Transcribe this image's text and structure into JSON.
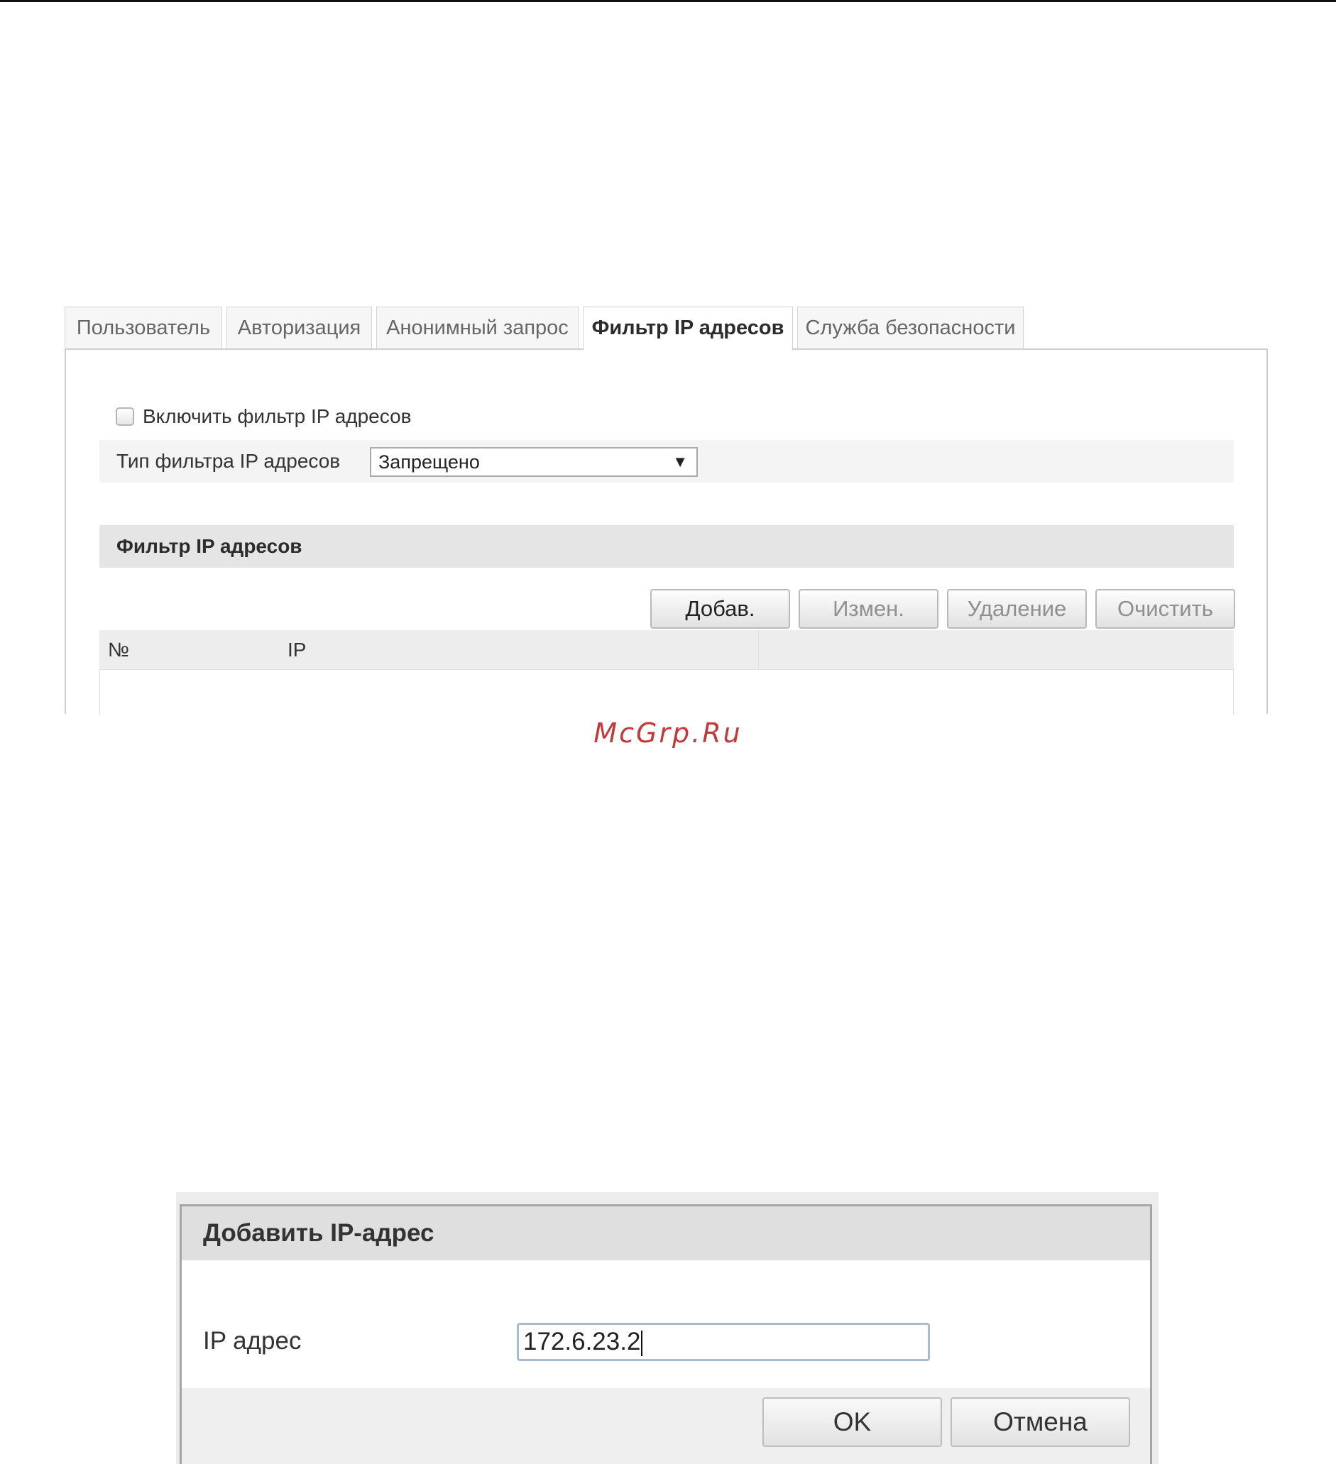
{
  "tabs": [
    {
      "label": "Пользователь",
      "active": false
    },
    {
      "label": "Авторизация",
      "active": false
    },
    {
      "label": "Анонимный запрос",
      "active": false
    },
    {
      "label": "Фильтр IP адресов",
      "active": true
    },
    {
      "label": "Служба безопасности",
      "active": false
    }
  ],
  "settings": {
    "enable_filter_label": "Включить фильтр IP адресов",
    "enable_filter_checked": false,
    "filter_type_label": "Тип фильтра IP адресов",
    "filter_type_value": "Запрещено"
  },
  "filter_section": {
    "title": "Фильтр IP адресов",
    "buttons": {
      "add": "Добав.",
      "edit": "Измен.",
      "delete": "Удаление",
      "clear": "Очистить"
    },
    "table": {
      "columns": [
        "№",
        "IP"
      ],
      "rows": []
    }
  },
  "watermark": "McGrp.Ru",
  "dialog": {
    "title": "Добавить IP-адрес",
    "ip_label": "IP адрес",
    "ip_value": "172.6.23.2",
    "ok_label": "OK",
    "cancel_label": "Отмена"
  },
  "colors": {
    "watermark": "#c0393b",
    "tab_active_text": "#2c2c2c",
    "disabled_text": "#8f8f8f"
  },
  "icons": {
    "select_arrow": "triangle-down-icon"
  }
}
